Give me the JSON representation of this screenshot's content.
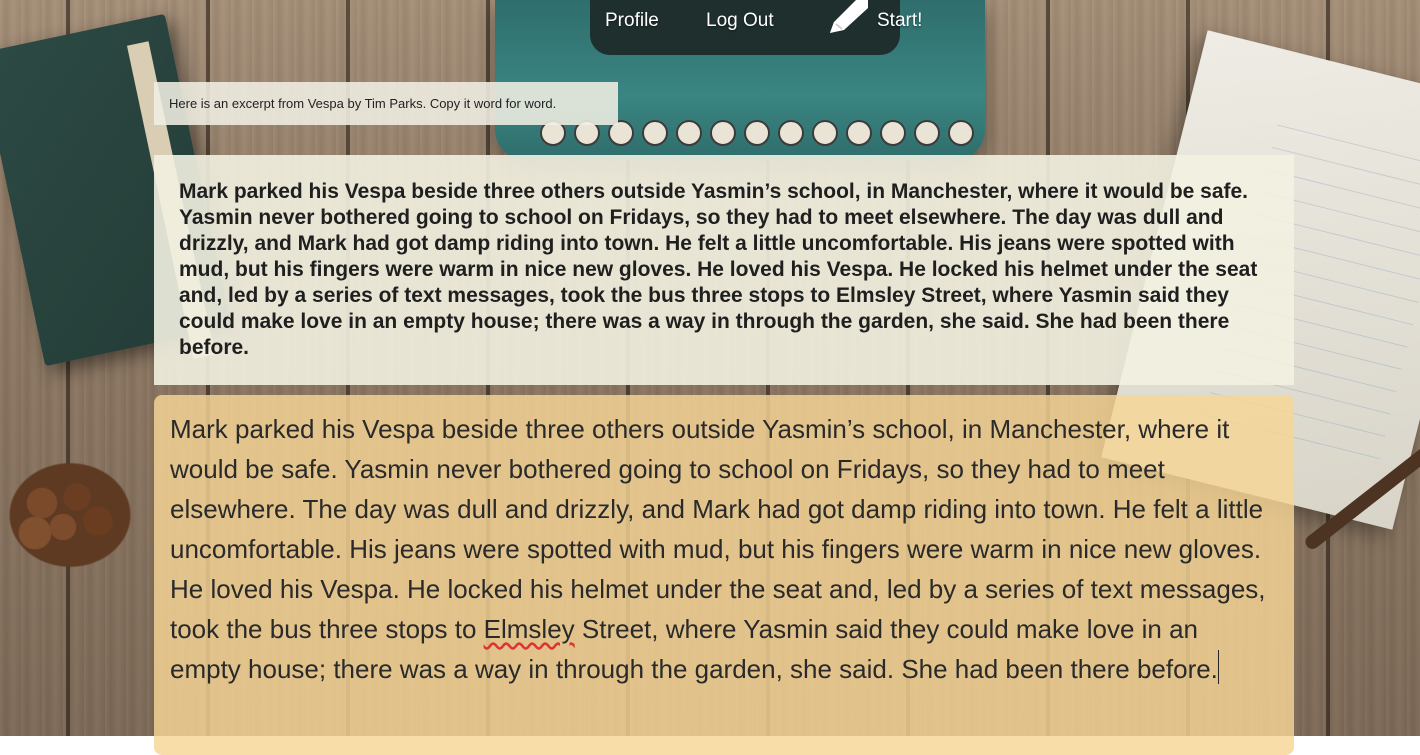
{
  "nav": {
    "profile_label": "Profile",
    "logout_label": "Log Out",
    "start_label": "Start!"
  },
  "instruction": {
    "text": "Here is an excerpt from Vespa by Tim Parks. Copy it word for word."
  },
  "excerpt": {
    "text": "Mark parked his Vespa beside three others outside Yasmin’s school, in Manchester, where it would be safe. Yasmin never bothered going to school on Fridays, so they had to meet elsewhere. The day was dull and drizzly, and Mark had got damp riding into town. He felt a little uncomfortable. His jeans were spotted with mud, but his fingers were warm in nice new gloves. He loved his Vespa. He locked his helmet under the seat and, led by a series of text messages, took the bus three stops to Elmsley Street, where Yasmin said they could make love in an empty house; there was a way in through the garden, she said. She had been there before."
  },
  "typing_area": {
    "text_before": "Mark parked his Vespa beside three others outside Yasmin’s school, in Manchester, where it would be safe. Yasmin never bothered going to school on Fridays, so they had to meet elsewhere. The day was dull and drizzly, and Mark had got damp riding into town. He felt a little uncomfortable. His jeans were spotted with mud, but his fingers were warm in nice new gloves. He loved his Vespa. He locked his helmet under the seat and, led by a series of text messages, took the bus three stops to ",
    "misspelled_word": "Elmsley",
    "text_after": " Street, where Yasmin said they could make love in an empty house; there was a way in through the garden, she said. She had been there before."
  },
  "icons": {
    "pencil": "pencil-icon"
  },
  "colors": {
    "typing_bg": "#f7d696",
    "excerpt_bg": "#f2f1e1",
    "nav_text": "#ffffff"
  }
}
